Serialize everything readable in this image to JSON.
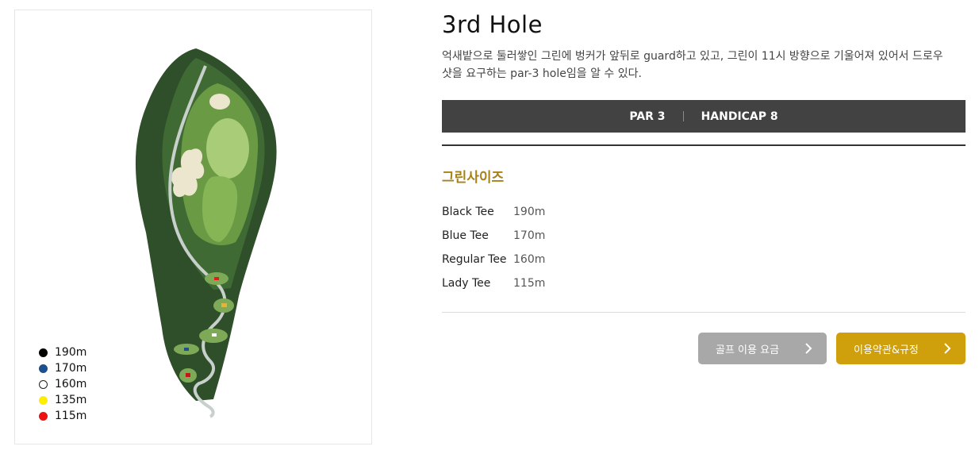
{
  "hole": {
    "title": "3rd Hole",
    "description": "억새밭으로 둘러쌓인 그린에 벙커가 앞뒤로 guard하고 있고, 그린이 11시 방향으로 기울어져 있어서 드로우 샷을 요구하는 par-3 hole임을 알 수 있다."
  },
  "par_bar": {
    "par": "PAR 3",
    "handicap": "HANDICAP 8"
  },
  "green_size_heading": "그린사이즈",
  "tees": [
    {
      "name": "Black Tee",
      "distance": "190m"
    },
    {
      "name": "Blue Tee",
      "distance": "170m"
    },
    {
      "name": "Regular Tee",
      "distance": "160m"
    },
    {
      "name": "Lady Tee",
      "distance": "115m"
    }
  ],
  "legend": [
    {
      "label": "190m",
      "color": "#000000"
    },
    {
      "label": "170m",
      "color": "#1b4f8e"
    },
    {
      "label": "160m",
      "color": "#ffffff"
    },
    {
      "label": "135m",
      "color": "#ffee00"
    },
    {
      "label": "115m",
      "color": "#ee1111"
    }
  ],
  "buttons": {
    "fee": {
      "label": "골프 이용 요금",
      "icon": "chevron-right-icon"
    },
    "terms": {
      "label": "이용약관&규정",
      "icon": "chevron-right-icon"
    }
  },
  "colors": {
    "gold": "#a68218",
    "button_gold": "#cf9f0c",
    "bar": "#424242"
  }
}
